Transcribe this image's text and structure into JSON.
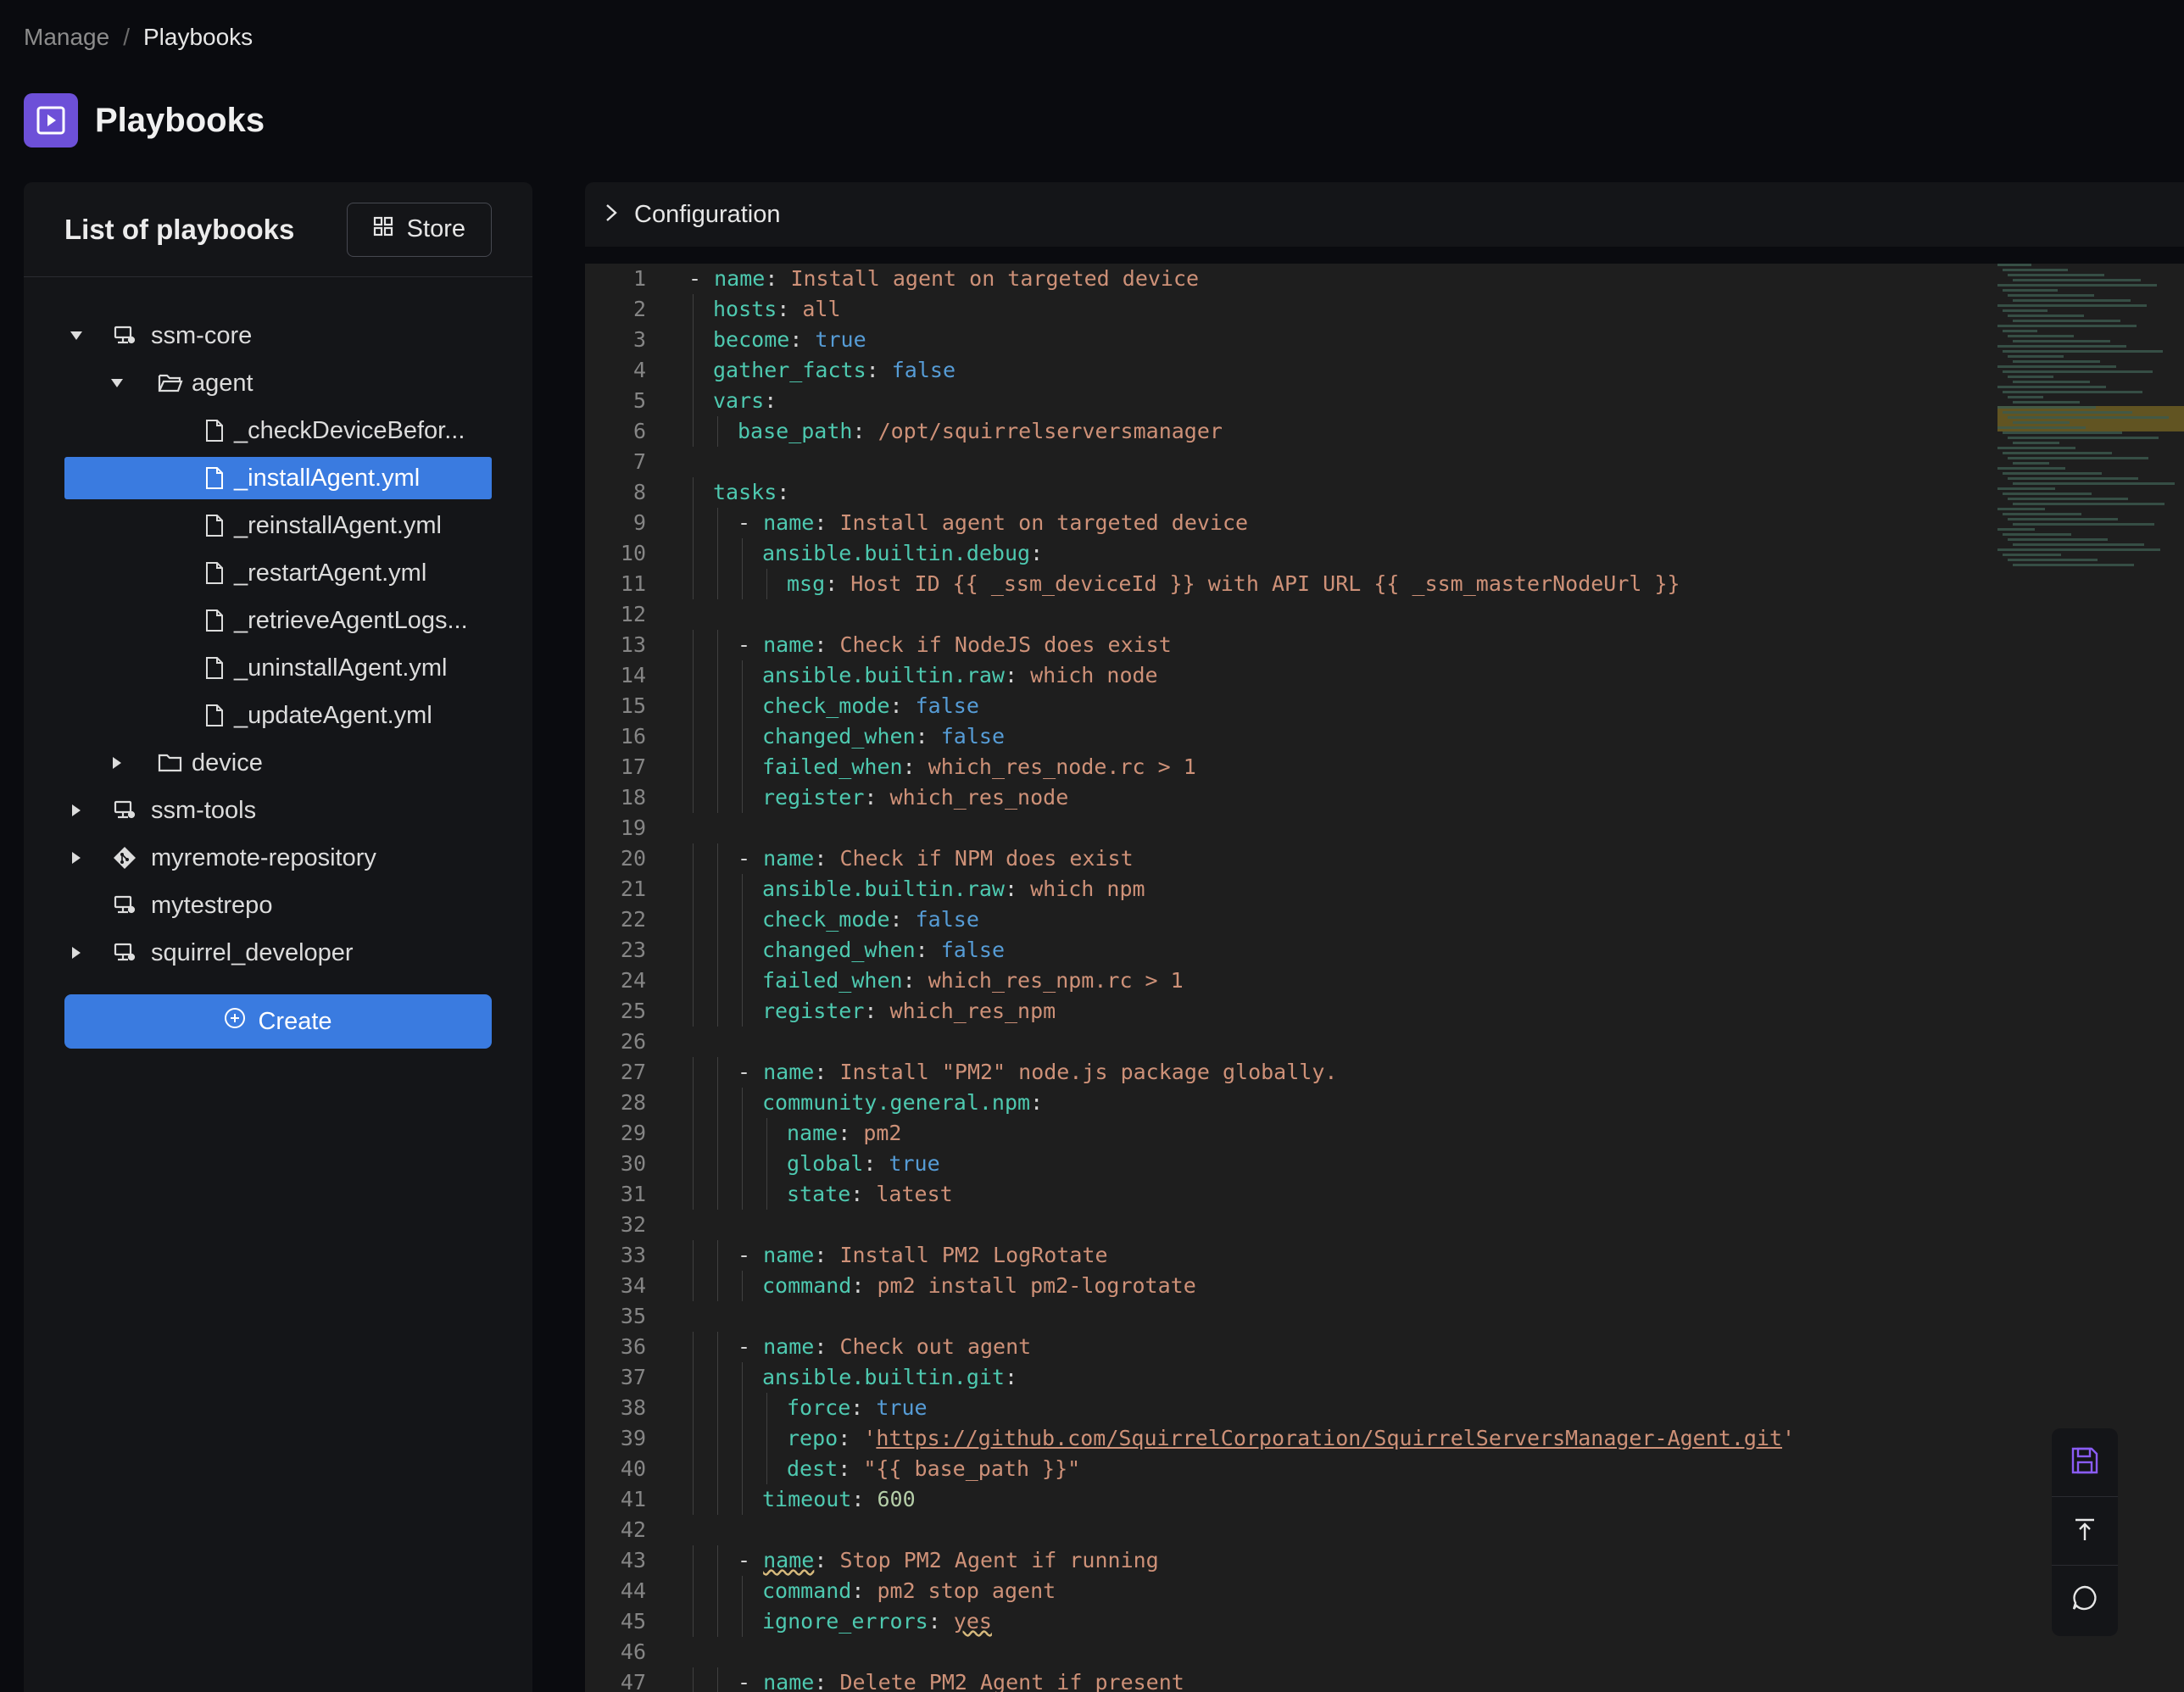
{
  "breadcrumb": {
    "parent": "Manage",
    "separator": "/",
    "current": "Playbooks"
  },
  "header": {
    "title": "Playbooks",
    "icon": "play-square-icon",
    "accent": "#6d50d8"
  },
  "left_panel": {
    "title": "List of playbooks",
    "store_label": "Store",
    "create_label": "Create",
    "tree": [
      {
        "label": "ssm-core",
        "type": "repo",
        "expanded": true
      },
      {
        "label": "agent",
        "type": "folder",
        "expanded": true
      },
      {
        "label": "_checkDeviceBefor...",
        "type": "file"
      },
      {
        "label": "_installAgent.yml",
        "type": "file",
        "selected": true
      },
      {
        "label": "_reinstallAgent.yml",
        "type": "file"
      },
      {
        "label": "_restartAgent.yml",
        "type": "file"
      },
      {
        "label": "_retrieveAgentLogs...",
        "type": "file"
      },
      {
        "label": "_uninstallAgent.yml",
        "type": "file"
      },
      {
        "label": "_updateAgent.yml",
        "type": "file"
      },
      {
        "label": "device",
        "type": "folder",
        "expanded": false
      },
      {
        "label": "ssm-tools",
        "type": "repo",
        "expanded": false
      },
      {
        "label": "myremote-repository",
        "type": "git",
        "expanded": false
      },
      {
        "label": "mytestrepo",
        "type": "repo"
      },
      {
        "label": "squirrel_developer",
        "type": "repo",
        "expanded": false
      }
    ],
    "selected_color": "#3a7be0"
  },
  "config": {
    "label": "Configuration"
  },
  "editor": {
    "lines": [
      "1",
      "2",
      "3",
      "4",
      "5",
      "6",
      "7",
      "8",
      "9",
      "10",
      "11",
      "12",
      "13",
      "14",
      "15",
      "16",
      "17",
      "18",
      "19",
      "20",
      "21",
      "22",
      "23",
      "24",
      "25",
      "26",
      "27",
      "28",
      "29",
      "30",
      "31",
      "32",
      "33",
      "34",
      "35",
      "36",
      "37",
      "38",
      "39",
      "40",
      "41",
      "42",
      "43",
      "44",
      "45",
      "46",
      "47"
    ]
  }
}
